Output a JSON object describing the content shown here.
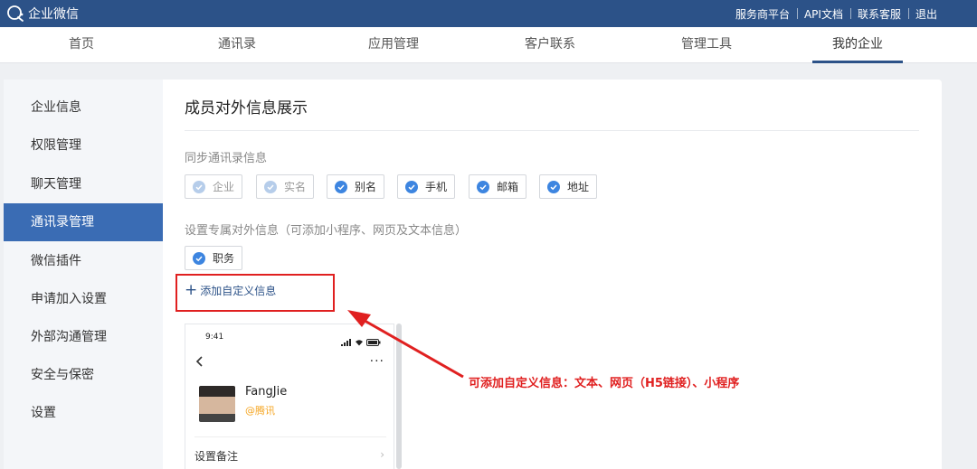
{
  "app": {
    "name": "企业微信"
  },
  "top_links": [
    "服务商平台",
    "API文档",
    "联系客服",
    "退出"
  ],
  "nav": {
    "tabs": [
      "首页",
      "通讯录",
      "应用管理",
      "客户联系",
      "管理工具",
      "我的企业"
    ],
    "active": "我的企业"
  },
  "sidebar": {
    "items": [
      "企业信息",
      "权限管理",
      "聊天管理",
      "通讯录管理",
      "微信插件",
      "申请加入设置",
      "外部沟通管理",
      "安全与保密",
      "设置"
    ],
    "active": "通讯录管理"
  },
  "content": {
    "title": "成员对外信息展示",
    "sync_label": "同步通讯录信息",
    "sync_chips": [
      {
        "label": "企业",
        "state": "disabled"
      },
      {
        "label": "实名",
        "state": "disabled"
      },
      {
        "label": "别名",
        "state": "checked"
      },
      {
        "label": "手机",
        "state": "checked"
      },
      {
        "label": "邮箱",
        "state": "checked"
      },
      {
        "label": "地址",
        "state": "checked"
      }
    ],
    "custom_label": "设置专属对外信息（可添加小程序、网页及文本信息）",
    "custom_chips": [
      {
        "label": "职务",
        "state": "checked"
      }
    ],
    "add_custom_label": "添加自定义信息"
  },
  "phone_preview": {
    "time": "9:41",
    "more": "···",
    "name": "FangJie",
    "org": "@腾讯",
    "remark_label": "设置备注",
    "remark_arrow": "›"
  },
  "annotation": {
    "text": "可添加自定义信息：文本、网页（H5链接）、小程序",
    "color": "#e02020"
  },
  "colors": {
    "topbar": "#2c5288",
    "active_sidebar": "#3a6cb4",
    "check": "#3d85e0",
    "check_disabled": "#b6cdea",
    "highlight": "#e02020",
    "org_text": "#f5a623"
  }
}
